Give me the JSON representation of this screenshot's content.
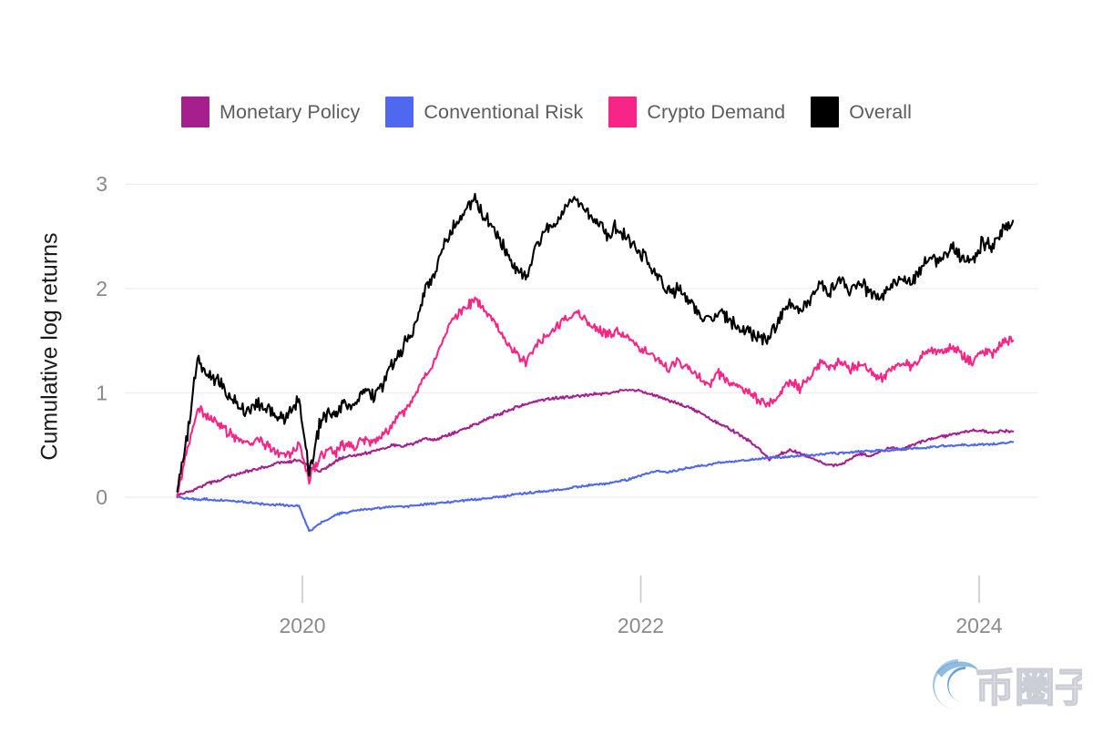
{
  "figure": {
    "background_color": "#ffffff",
    "watermark": {
      "text": "币圈子",
      "logo_name": "swirl-circle-logo",
      "color": "#6aa9e0"
    }
  },
  "legend": {
    "position": "top-center",
    "items": [
      {
        "label": "Monetary Policy",
        "color": "#a61f8f"
      },
      {
        "label": "Conventional Risk",
        "color": "#5068ef"
      },
      {
        "label": "Crypto Demand",
        "color": "#f72585"
      },
      {
        "label": "Overall",
        "color": "#000000"
      }
    ]
  },
  "chart_data": {
    "type": "line",
    "title": "",
    "subtitle": "",
    "xlabel": "",
    "ylabel": "Cumulative log returns",
    "xtick_labels": [
      "2020",
      "2022",
      "2024"
    ],
    "xtick_values": [
      2020,
      2022,
      2024
    ],
    "ytick_labels": [
      "0",
      "1",
      "2",
      "3"
    ],
    "ytick_values": [
      0,
      1,
      2,
      3
    ],
    "xlim": [
      2018.95,
      2024.35
    ],
    "ylim": [
      -0.47,
      3.15
    ],
    "grid": "horizontal",
    "grid_color": "#f0f0f0",
    "legend_position": "top-center",
    "series": [
      {
        "name": "Monetary Policy",
        "color": "#a61f8f",
        "x": [
          2019.26,
          2019.32,
          2019.38,
          2019.44,
          2019.5,
          2019.56,
          2019.62,
          2019.68,
          2019.74,
          2019.8,
          2019.86,
          2019.92,
          2019.98,
          2020.04,
          2020.1,
          2020.16,
          2020.2,
          2020.24,
          2020.3,
          2020.36,
          2020.42,
          2020.48,
          2020.54,
          2020.6,
          2020.66,
          2020.72,
          2020.78,
          2020.84,
          2020.9,
          2020.96,
          2021.02,
          2021.08,
          2021.14,
          2021.2,
          2021.26,
          2021.32,
          2021.38,
          2021.44,
          2021.5,
          2021.56,
          2021.62,
          2021.68,
          2021.74,
          2021.8,
          2021.86,
          2021.92,
          2021.98,
          2022.04,
          2022.1,
          2022.16,
          2022.22,
          2022.28,
          2022.34,
          2022.4,
          2022.46,
          2022.52,
          2022.58,
          2022.64,
          2022.7,
          2022.76,
          2022.82,
          2022.88,
          2022.94,
          2023.0,
          2023.06,
          2023.12,
          2023.18,
          2023.24,
          2023.3,
          2023.36,
          2023.42,
          2023.48,
          2023.54,
          2023.6,
          2023.66,
          2023.72,
          2023.78,
          2023.84,
          2023.9,
          2023.96,
          2024.02,
          2024.08,
          2024.14,
          2024.2
        ],
        "y": [
          0.02,
          0.05,
          0.09,
          0.13,
          0.16,
          0.2,
          0.22,
          0.25,
          0.27,
          0.3,
          0.33,
          0.34,
          0.36,
          0.29,
          0.24,
          0.3,
          0.35,
          0.38,
          0.4,
          0.42,
          0.44,
          0.47,
          0.5,
          0.49,
          0.52,
          0.56,
          0.55,
          0.58,
          0.62,
          0.66,
          0.7,
          0.74,
          0.78,
          0.82,
          0.86,
          0.89,
          0.92,
          0.94,
          0.95,
          0.96,
          0.97,
          0.98,
          0.99,
          1.0,
          1.01,
          1.03,
          1.02,
          1.0,
          0.97,
          0.93,
          0.9,
          0.86,
          0.82,
          0.76,
          0.71,
          0.66,
          0.6,
          0.54,
          0.46,
          0.36,
          0.41,
          0.45,
          0.42,
          0.38,
          0.34,
          0.3,
          0.32,
          0.37,
          0.42,
          0.39,
          0.44,
          0.48,
          0.45,
          0.5,
          0.53,
          0.56,
          0.58,
          0.6,
          0.62,
          0.64,
          0.63,
          0.62,
          0.63,
          0.63
        ]
      },
      {
        "name": "Conventional Risk",
        "color": "#5068ef",
        "x": [
          2019.26,
          2019.32,
          2019.38,
          2019.44,
          2019.5,
          2019.56,
          2019.62,
          2019.68,
          2019.74,
          2019.8,
          2019.86,
          2019.92,
          2019.98,
          2020.04,
          2020.1,
          2020.16,
          2020.2,
          2020.24,
          2020.3,
          2020.36,
          2020.42,
          2020.48,
          2020.54,
          2020.6,
          2020.66,
          2020.72,
          2020.78,
          2020.84,
          2020.9,
          2020.96,
          2021.02,
          2021.08,
          2021.14,
          2021.2,
          2021.26,
          2021.32,
          2021.38,
          2021.44,
          2021.5,
          2021.56,
          2021.62,
          2021.68,
          2021.74,
          2021.8,
          2021.86,
          2021.92,
          2021.98,
          2022.04,
          2022.1,
          2022.16,
          2022.22,
          2022.28,
          2022.34,
          2022.4,
          2022.46,
          2022.52,
          2022.58,
          2022.64,
          2022.7,
          2022.76,
          2022.82,
          2022.88,
          2022.94,
          2023.0,
          2023.06,
          2023.12,
          2023.18,
          2023.24,
          2023.3,
          2023.36,
          2023.42,
          2023.48,
          2023.54,
          2023.6,
          2023.66,
          2023.72,
          2023.78,
          2023.84,
          2023.9,
          2023.96,
          2024.02,
          2024.08,
          2024.14,
          2024.2
        ],
        "y": [
          0.0,
          -0.01,
          -0.02,
          -0.02,
          -0.03,
          -0.03,
          -0.04,
          -0.05,
          -0.06,
          -0.07,
          -0.07,
          -0.08,
          -0.08,
          -0.33,
          -0.25,
          -0.2,
          -0.17,
          -0.15,
          -0.13,
          -0.12,
          -0.11,
          -0.1,
          -0.09,
          -0.09,
          -0.08,
          -0.07,
          -0.06,
          -0.05,
          -0.04,
          -0.03,
          -0.02,
          -0.01,
          0.0,
          0.01,
          0.03,
          0.04,
          0.05,
          0.06,
          0.07,
          0.08,
          0.1,
          0.11,
          0.12,
          0.13,
          0.15,
          0.17,
          0.2,
          0.23,
          0.25,
          0.24,
          0.26,
          0.28,
          0.3,
          0.31,
          0.33,
          0.34,
          0.35,
          0.36,
          0.37,
          0.38,
          0.38,
          0.39,
          0.4,
          0.4,
          0.41,
          0.42,
          0.42,
          0.43,
          0.44,
          0.44,
          0.45,
          0.45,
          0.46,
          0.47,
          0.47,
          0.48,
          0.49,
          0.49,
          0.5,
          0.5,
          0.51,
          0.51,
          0.52,
          0.53
        ]
      },
      {
        "name": "Crypto Demand",
        "color": "#f72585",
        "x": [
          2019.26,
          2019.32,
          2019.38,
          2019.44,
          2019.5,
          2019.56,
          2019.62,
          2019.68,
          2019.74,
          2019.8,
          2019.86,
          2019.92,
          2019.98,
          2020.04,
          2020.1,
          2020.16,
          2020.2,
          2020.24,
          2020.3,
          2020.36,
          2020.42,
          2020.48,
          2020.54,
          2020.6,
          2020.66,
          2020.72,
          2020.78,
          2020.84,
          2020.9,
          2020.96,
          2021.02,
          2021.08,
          2021.14,
          2021.2,
          2021.26,
          2021.32,
          2021.38,
          2021.44,
          2021.5,
          2021.56,
          2021.62,
          2021.68,
          2021.74,
          2021.8,
          2021.86,
          2021.92,
          2021.98,
          2022.04,
          2022.1,
          2022.16,
          2022.22,
          2022.28,
          2022.34,
          2022.4,
          2022.46,
          2022.52,
          2022.58,
          2022.64,
          2022.7,
          2022.76,
          2022.82,
          2022.88,
          2022.94,
          2023.0,
          2023.06,
          2023.12,
          2023.18,
          2023.24,
          2023.3,
          2023.36,
          2023.42,
          2023.48,
          2023.54,
          2023.6,
          2023.66,
          2023.72,
          2023.78,
          2023.84,
          2023.9,
          2023.96,
          2024.02,
          2024.08,
          2024.14,
          2024.2
        ],
        "y": [
          0.03,
          0.45,
          0.85,
          0.78,
          0.72,
          0.62,
          0.55,
          0.52,
          0.56,
          0.48,
          0.42,
          0.4,
          0.5,
          0.18,
          0.38,
          0.45,
          0.42,
          0.5,
          0.48,
          0.55,
          0.52,
          0.6,
          0.72,
          0.82,
          0.95,
          1.15,
          1.3,
          1.55,
          1.72,
          1.8,
          1.9,
          1.78,
          1.65,
          1.5,
          1.38,
          1.3,
          1.45,
          1.55,
          1.62,
          1.72,
          1.78,
          1.68,
          1.62,
          1.55,
          1.6,
          1.52,
          1.45,
          1.38,
          1.32,
          1.22,
          1.3,
          1.25,
          1.15,
          1.08,
          1.18,
          1.12,
          1.05,
          1.0,
          0.92,
          0.88,
          1.0,
          1.1,
          1.05,
          1.15,
          1.28,
          1.22,
          1.3,
          1.22,
          1.28,
          1.2,
          1.15,
          1.22,
          1.3,
          1.25,
          1.35,
          1.42,
          1.38,
          1.45,
          1.35,
          1.3,
          1.42,
          1.38,
          1.48,
          1.5
        ]
      },
      {
        "name": "Overall",
        "color": "#000000",
        "x": [
          2019.26,
          2019.32,
          2019.38,
          2019.44,
          2019.5,
          2019.56,
          2019.62,
          2019.68,
          2019.74,
          2019.8,
          2019.86,
          2019.92,
          2019.98,
          2020.04,
          2020.1,
          2020.16,
          2020.2,
          2020.24,
          2020.3,
          2020.36,
          2020.42,
          2020.48,
          2020.54,
          2020.6,
          2020.66,
          2020.72,
          2020.78,
          2020.84,
          2020.9,
          2020.96,
          2021.02,
          2021.08,
          2021.14,
          2021.2,
          2021.26,
          2021.32,
          2021.38,
          2021.44,
          2021.5,
          2021.56,
          2021.62,
          2021.68,
          2021.74,
          2021.8,
          2021.86,
          2021.92,
          2021.98,
          2022.04,
          2022.1,
          2022.16,
          2022.22,
          2022.28,
          2022.34,
          2022.4,
          2022.46,
          2022.52,
          2022.58,
          2022.64,
          2022.7,
          2022.76,
          2022.82,
          2022.88,
          2022.94,
          2023.0,
          2023.06,
          2023.12,
          2023.18,
          2023.24,
          2023.3,
          2023.36,
          2023.42,
          2023.48,
          2023.54,
          2023.6,
          2023.66,
          2023.72,
          2023.78,
          2023.84,
          2023.9,
          2023.96,
          2024.02,
          2024.08,
          2024.14,
          2024.2
        ],
        "y": [
          0.05,
          0.6,
          1.3,
          1.18,
          1.12,
          1.0,
          0.88,
          0.82,
          0.9,
          0.85,
          0.75,
          0.78,
          0.95,
          0.22,
          0.68,
          0.82,
          0.78,
          0.92,
          0.88,
          1.0,
          0.98,
          1.1,
          1.3,
          1.45,
          1.62,
          1.95,
          2.15,
          2.45,
          2.6,
          2.72,
          2.85,
          2.68,
          2.55,
          2.35,
          2.2,
          2.12,
          2.4,
          2.55,
          2.62,
          2.78,
          2.88,
          2.75,
          2.62,
          2.5,
          2.6,
          2.48,
          2.35,
          2.28,
          2.12,
          1.95,
          2.0,
          1.9,
          1.78,
          1.68,
          1.78,
          1.7,
          1.62,
          1.58,
          1.5,
          1.52,
          1.72,
          1.85,
          1.78,
          1.9,
          2.05,
          1.98,
          2.08,
          1.98,
          2.05,
          1.95,
          1.9,
          2.0,
          2.1,
          2.05,
          2.2,
          2.3,
          2.25,
          2.4,
          2.3,
          2.25,
          2.45,
          2.4,
          2.55,
          2.65
        ]
      }
    ]
  }
}
